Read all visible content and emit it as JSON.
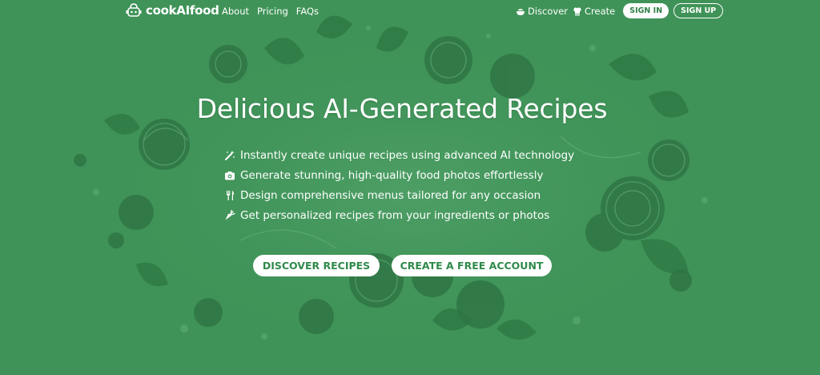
{
  "colors": {
    "background": "#3f9358",
    "accent": "#2f8a4a"
  },
  "brand": {
    "name": "cookAIfood",
    "icon": "chef-robot-icon"
  },
  "nav": {
    "links": [
      "About",
      "Pricing",
      "FAQs"
    ]
  },
  "account": {
    "discover_label": "Discover",
    "create_label": "Create",
    "signin_label": "SIGN IN",
    "signup_label": "SIGN UP"
  },
  "hero": {
    "title": "Delicious AI-Generated Recipes",
    "features": [
      {
        "icon": "magic-wand-icon",
        "text": "Instantly create unique recipes using advanced AI technology"
      },
      {
        "icon": "camera-icon",
        "text": "Generate stunning, high-quality food photos effortlessly"
      },
      {
        "icon": "utensils-icon",
        "text": "Design comprehensive menus tailored for any occasion"
      },
      {
        "icon": "carrot-icon",
        "text": "Get personalized recipes from your ingredients or photos"
      }
    ],
    "cta_discover": "DISCOVER RECIPES",
    "cta_create": "CREATE A FREE ACCOUNT"
  }
}
